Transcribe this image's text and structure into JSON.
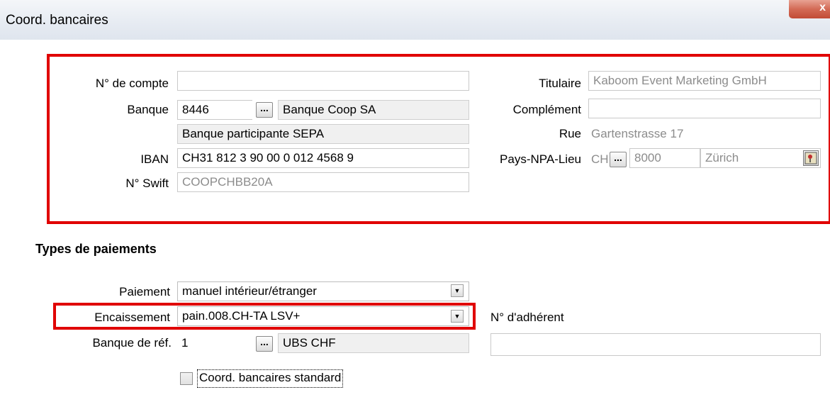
{
  "window": {
    "title": "Coord. bancaires",
    "close_glyph": "x"
  },
  "account": {
    "account_no_label": "N° de compte",
    "account_no_value": "",
    "bank_label": "Banque",
    "bank_code": "8446",
    "bank_lookup_label": "...",
    "bank_name": "Banque Coop SA",
    "sepa_status": "Banque participante SEPA",
    "iban_label": "IBAN",
    "iban_value": "CH31  812 3 90 00 0 012  4568  9",
    "swift_label": "N° Swift",
    "swift_value": "COOPCHBB20A"
  },
  "holder": {
    "holder_label": "Titulaire",
    "holder_value": "Kaboom Event Marketing GmbH",
    "complement_label": "Complément",
    "complement_value": "",
    "street_label": "Rue",
    "street_value": "Gartenstrasse 17",
    "country_zip_city_label": "Pays-NPA-Lieu",
    "country_value": "CH",
    "country_lookup_label": "...",
    "zip_value": "8000",
    "city_value": "Zürich",
    "map_icon": "map-icon"
  },
  "payment_types": {
    "section_title": "Types de paiements",
    "payment_label": "Paiement",
    "payment_value": "manuel intérieur/étranger",
    "collection_label": "Encaissement",
    "collection_value": "pain.008.CH-TA LSV+",
    "member_no_label": "N° d'adhérent",
    "member_no_value": "",
    "ref_bank_label": "Banque de réf.",
    "ref_bank_code": "1",
    "ref_bank_lookup_label": "...",
    "ref_bank_name": "UBS CHF",
    "standard_checkbox_label": "Coord. bancaires standard",
    "standard_checked": false
  },
  "colors": {
    "highlight_border": "#e00000",
    "readonly_text": "#8c8c8c"
  }
}
